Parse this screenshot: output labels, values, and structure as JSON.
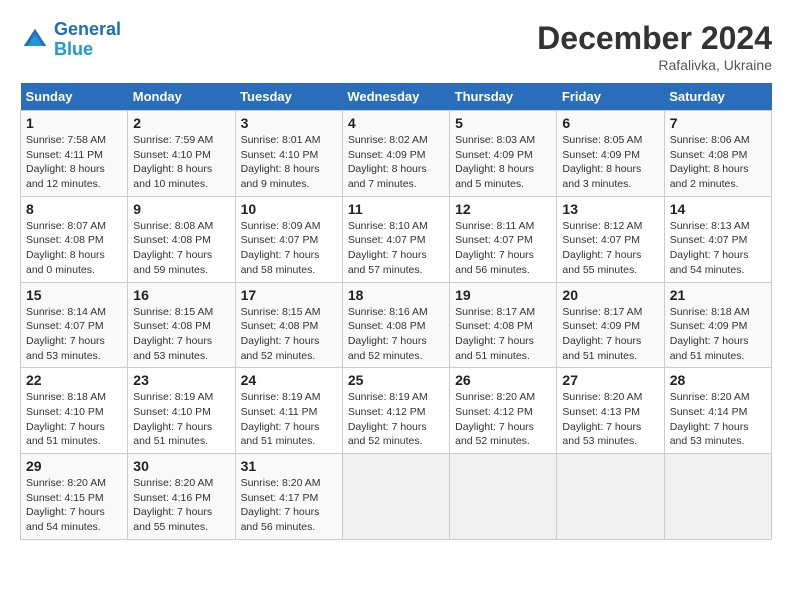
{
  "header": {
    "logo_line1": "General",
    "logo_line2": "Blue",
    "month": "December 2024",
    "location": "Rafalivka, Ukraine"
  },
  "weekdays": [
    "Sunday",
    "Monday",
    "Tuesday",
    "Wednesday",
    "Thursday",
    "Friday",
    "Saturday"
  ],
  "weeks": [
    [
      {
        "day": "1",
        "sunrise": "Sunrise: 7:58 AM",
        "sunset": "Sunset: 4:11 PM",
        "daylight": "Daylight: 8 hours and 12 minutes."
      },
      {
        "day": "2",
        "sunrise": "Sunrise: 7:59 AM",
        "sunset": "Sunset: 4:10 PM",
        "daylight": "Daylight: 8 hours and 10 minutes."
      },
      {
        "day": "3",
        "sunrise": "Sunrise: 8:01 AM",
        "sunset": "Sunset: 4:10 PM",
        "daylight": "Daylight: 8 hours and 9 minutes."
      },
      {
        "day": "4",
        "sunrise": "Sunrise: 8:02 AM",
        "sunset": "Sunset: 4:09 PM",
        "daylight": "Daylight: 8 hours and 7 minutes."
      },
      {
        "day": "5",
        "sunrise": "Sunrise: 8:03 AM",
        "sunset": "Sunset: 4:09 PM",
        "daylight": "Daylight: 8 hours and 5 minutes."
      },
      {
        "day": "6",
        "sunrise": "Sunrise: 8:05 AM",
        "sunset": "Sunset: 4:09 PM",
        "daylight": "Daylight: 8 hours and 3 minutes."
      },
      {
        "day": "7",
        "sunrise": "Sunrise: 8:06 AM",
        "sunset": "Sunset: 4:08 PM",
        "daylight": "Daylight: 8 hours and 2 minutes."
      }
    ],
    [
      {
        "day": "8",
        "sunrise": "Sunrise: 8:07 AM",
        "sunset": "Sunset: 4:08 PM",
        "daylight": "Daylight: 8 hours and 0 minutes."
      },
      {
        "day": "9",
        "sunrise": "Sunrise: 8:08 AM",
        "sunset": "Sunset: 4:08 PM",
        "daylight": "Daylight: 7 hours and 59 minutes."
      },
      {
        "day": "10",
        "sunrise": "Sunrise: 8:09 AM",
        "sunset": "Sunset: 4:07 PM",
        "daylight": "Daylight: 7 hours and 58 minutes."
      },
      {
        "day": "11",
        "sunrise": "Sunrise: 8:10 AM",
        "sunset": "Sunset: 4:07 PM",
        "daylight": "Daylight: 7 hours and 57 minutes."
      },
      {
        "day": "12",
        "sunrise": "Sunrise: 8:11 AM",
        "sunset": "Sunset: 4:07 PM",
        "daylight": "Daylight: 7 hours and 56 minutes."
      },
      {
        "day": "13",
        "sunrise": "Sunrise: 8:12 AM",
        "sunset": "Sunset: 4:07 PM",
        "daylight": "Daylight: 7 hours and 55 minutes."
      },
      {
        "day": "14",
        "sunrise": "Sunrise: 8:13 AM",
        "sunset": "Sunset: 4:07 PM",
        "daylight": "Daylight: 7 hours and 54 minutes."
      }
    ],
    [
      {
        "day": "15",
        "sunrise": "Sunrise: 8:14 AM",
        "sunset": "Sunset: 4:07 PM",
        "daylight": "Daylight: 7 hours and 53 minutes."
      },
      {
        "day": "16",
        "sunrise": "Sunrise: 8:15 AM",
        "sunset": "Sunset: 4:08 PM",
        "daylight": "Daylight: 7 hours and 53 minutes."
      },
      {
        "day": "17",
        "sunrise": "Sunrise: 8:15 AM",
        "sunset": "Sunset: 4:08 PM",
        "daylight": "Daylight: 7 hours and 52 minutes."
      },
      {
        "day": "18",
        "sunrise": "Sunrise: 8:16 AM",
        "sunset": "Sunset: 4:08 PM",
        "daylight": "Daylight: 7 hours and 52 minutes."
      },
      {
        "day": "19",
        "sunrise": "Sunrise: 8:17 AM",
        "sunset": "Sunset: 4:08 PM",
        "daylight": "Daylight: 7 hours and 51 minutes."
      },
      {
        "day": "20",
        "sunrise": "Sunrise: 8:17 AM",
        "sunset": "Sunset: 4:09 PM",
        "daylight": "Daylight: 7 hours and 51 minutes."
      },
      {
        "day": "21",
        "sunrise": "Sunrise: 8:18 AM",
        "sunset": "Sunset: 4:09 PM",
        "daylight": "Daylight: 7 hours and 51 minutes."
      }
    ],
    [
      {
        "day": "22",
        "sunrise": "Sunrise: 8:18 AM",
        "sunset": "Sunset: 4:10 PM",
        "daylight": "Daylight: 7 hours and 51 minutes."
      },
      {
        "day": "23",
        "sunrise": "Sunrise: 8:19 AM",
        "sunset": "Sunset: 4:10 PM",
        "daylight": "Daylight: 7 hours and 51 minutes."
      },
      {
        "day": "24",
        "sunrise": "Sunrise: 8:19 AM",
        "sunset": "Sunset: 4:11 PM",
        "daylight": "Daylight: 7 hours and 51 minutes."
      },
      {
        "day": "25",
        "sunrise": "Sunrise: 8:19 AM",
        "sunset": "Sunset: 4:12 PM",
        "daylight": "Daylight: 7 hours and 52 minutes."
      },
      {
        "day": "26",
        "sunrise": "Sunrise: 8:20 AM",
        "sunset": "Sunset: 4:12 PM",
        "daylight": "Daylight: 7 hours and 52 minutes."
      },
      {
        "day": "27",
        "sunrise": "Sunrise: 8:20 AM",
        "sunset": "Sunset: 4:13 PM",
        "daylight": "Daylight: 7 hours and 53 minutes."
      },
      {
        "day": "28",
        "sunrise": "Sunrise: 8:20 AM",
        "sunset": "Sunset: 4:14 PM",
        "daylight": "Daylight: 7 hours and 53 minutes."
      }
    ],
    [
      {
        "day": "29",
        "sunrise": "Sunrise: 8:20 AM",
        "sunset": "Sunset: 4:15 PM",
        "daylight": "Daylight: 7 hours and 54 minutes."
      },
      {
        "day": "30",
        "sunrise": "Sunrise: 8:20 AM",
        "sunset": "Sunset: 4:16 PM",
        "daylight": "Daylight: 7 hours and 55 minutes."
      },
      {
        "day": "31",
        "sunrise": "Sunrise: 8:20 AM",
        "sunset": "Sunset: 4:17 PM",
        "daylight": "Daylight: 7 hours and 56 minutes."
      },
      null,
      null,
      null,
      null
    ]
  ]
}
